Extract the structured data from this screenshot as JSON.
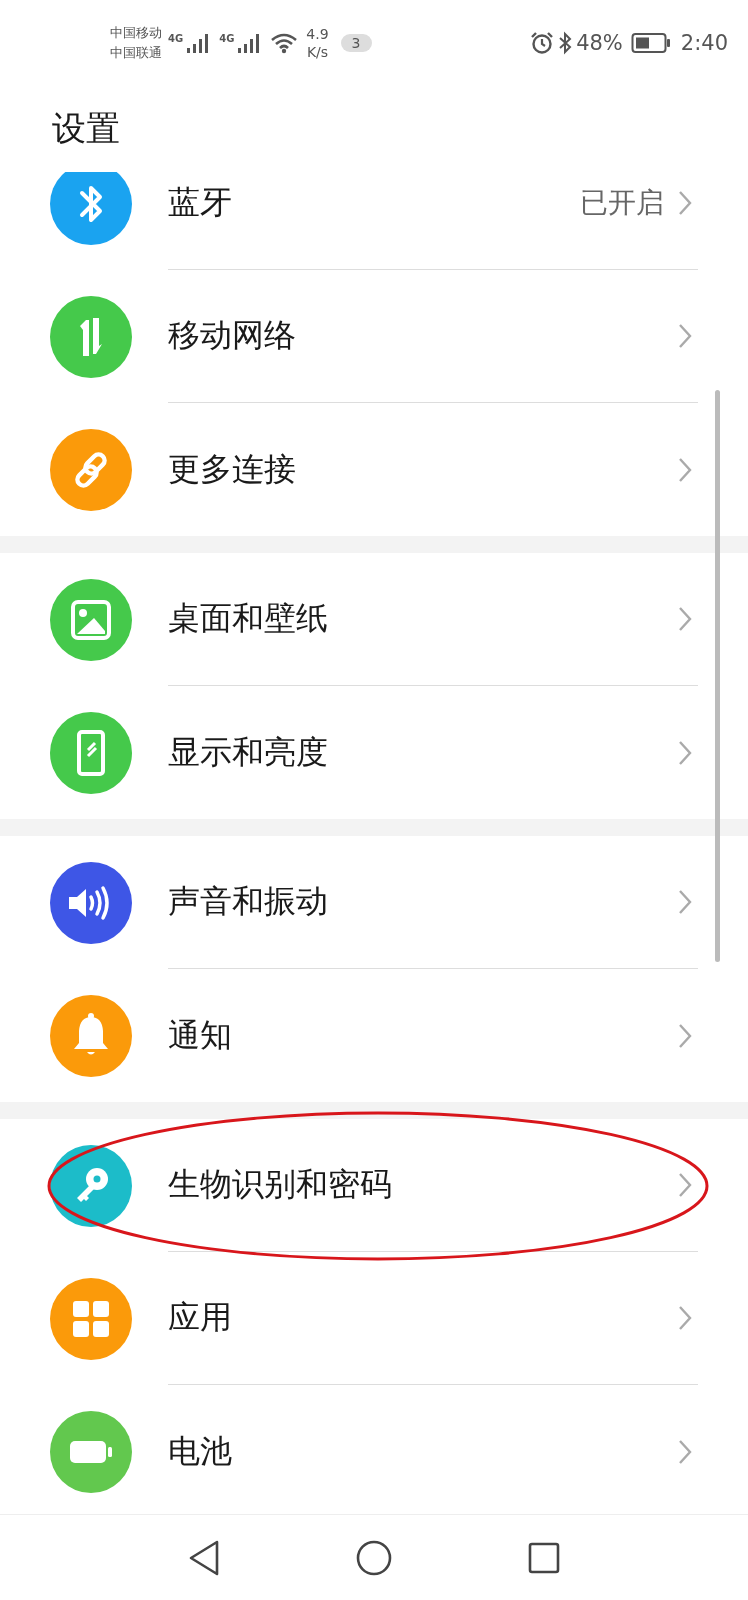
{
  "status_bar": {
    "carriers": [
      "中国移动",
      "中国联通"
    ],
    "network_1": "4G",
    "network_2": "4G",
    "speed": [
      "4.9",
      "K/s"
    ],
    "notification_count": "3",
    "battery_percent": "48%",
    "time": "2:40"
  },
  "title": "设置",
  "sections": [
    {
      "items": [
        {
          "kind": "bluetooth",
          "color": "#1aa3f0",
          "label": "蓝牙",
          "value": "已开启",
          "circled": false
        },
        {
          "kind": "mobile-data",
          "color": "#45c94b",
          "label": "移动网络",
          "circled": false
        },
        {
          "kind": "link",
          "color": "#fb9a0a",
          "label": "更多连接",
          "circled": false
        }
      ]
    },
    {
      "items": [
        {
          "kind": "wallpaper",
          "color": "#45c94b",
          "label": "桌面和壁纸",
          "circled": false
        },
        {
          "kind": "display",
          "color": "#45c94b",
          "label": "显示和亮度",
          "circled": false
        }
      ]
    },
    {
      "items": [
        {
          "kind": "sound",
          "color": "#3e56e6",
          "label": "声音和振动",
          "circled": false
        },
        {
          "kind": "notification",
          "color": "#fb9a0a",
          "label": "通知",
          "circled": false
        }
      ]
    },
    {
      "items": [
        {
          "kind": "key",
          "color": "#1cbcc9",
          "label": "生物识别和密码",
          "circled": true
        },
        {
          "kind": "apps",
          "color": "#fb9a0a",
          "label": "应用",
          "circled": false
        },
        {
          "kind": "battery",
          "color": "#62c84e",
          "label": "电池",
          "circled": false
        }
      ]
    }
  ]
}
